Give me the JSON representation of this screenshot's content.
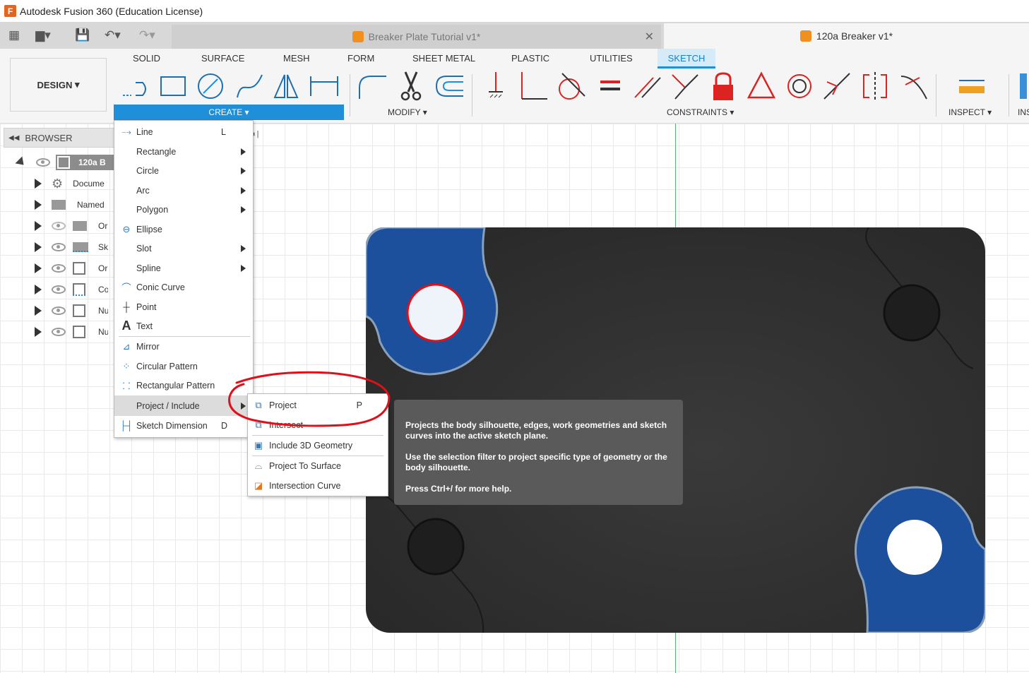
{
  "window": {
    "title": "Autodesk Fusion 360 (Education License)",
    "logo_letter": "F"
  },
  "tabs": [
    {
      "label": "Breaker Plate Tutorial v1*",
      "active": false
    },
    {
      "label": "120a Breaker v1*",
      "active": true
    }
  ],
  "ribbon": {
    "workspace": "DESIGN",
    "tabs": [
      "SOLID",
      "SURFACE",
      "MESH",
      "FORM",
      "SHEET METAL",
      "PLASTIC",
      "UTILITIES",
      "SKETCH"
    ],
    "active_tab": "SKETCH",
    "groups": {
      "create": "CREATE",
      "modify": "MODIFY",
      "constraints": "CONSTRAINTS",
      "inspect": "INSPECT",
      "insert": "INS"
    }
  },
  "browser": {
    "title": "BROWSER",
    "root": "120a B",
    "items": [
      "Docume",
      "Named",
      "Or",
      "Sk",
      "Or",
      "Co",
      "Nu",
      "Nu"
    ]
  },
  "create_menu": {
    "items": [
      {
        "label": "Line",
        "shortcut": "L",
        "submenu": false,
        "icon": "line-icon"
      },
      {
        "label": "Rectangle",
        "submenu": true
      },
      {
        "label": "Circle",
        "submenu": true
      },
      {
        "label": "Arc",
        "submenu": true
      },
      {
        "label": "Polygon",
        "submenu": true
      },
      {
        "label": "Ellipse",
        "submenu": false,
        "icon": "ellipse-icon"
      },
      {
        "label": "Slot",
        "submenu": true
      },
      {
        "label": "Spline",
        "submenu": true
      },
      {
        "label": "Conic Curve",
        "submenu": false,
        "icon": "conic-icon"
      },
      {
        "label": "Point",
        "submenu": false,
        "icon": "point-icon"
      },
      {
        "label": "Text",
        "submenu": false,
        "icon": "text-icon"
      },
      {
        "label": "Mirror",
        "submenu": false,
        "icon": "mirror-icon"
      },
      {
        "label": "Circular Pattern",
        "submenu": false,
        "icon": "circular-pattern-icon"
      },
      {
        "label": "Rectangular Pattern",
        "submenu": false,
        "icon": "rectangular-pattern-icon"
      },
      {
        "label": "Project / Include",
        "submenu": true,
        "highlighted": true
      },
      {
        "label": "Sketch Dimension",
        "shortcut": "D",
        "submenu": false,
        "icon": "dimension-icon"
      }
    ]
  },
  "project_submenu": {
    "items": [
      {
        "label": "Project",
        "shortcut": "P"
      },
      {
        "label": "Intersect"
      },
      {
        "label": "Include 3D Geometry"
      },
      {
        "label": "Project To Surface"
      },
      {
        "label": "Intersection Curve"
      }
    ]
  },
  "tooltip": {
    "line1": "Projects the body silhouette, edges, work geometries and sketch curves into the active sketch plane.",
    "line2": "Use the selection filter to project specific type of geometry or the body silhouette.",
    "line3": "Press Ctrl+/ for more help."
  },
  "colors": {
    "accent": "#1e8fd8",
    "plate": "#2b2b2b",
    "profile_blue": "#1c4f9c",
    "axis_green": "#4fbf6f",
    "annotation_red": "#e0101a"
  }
}
